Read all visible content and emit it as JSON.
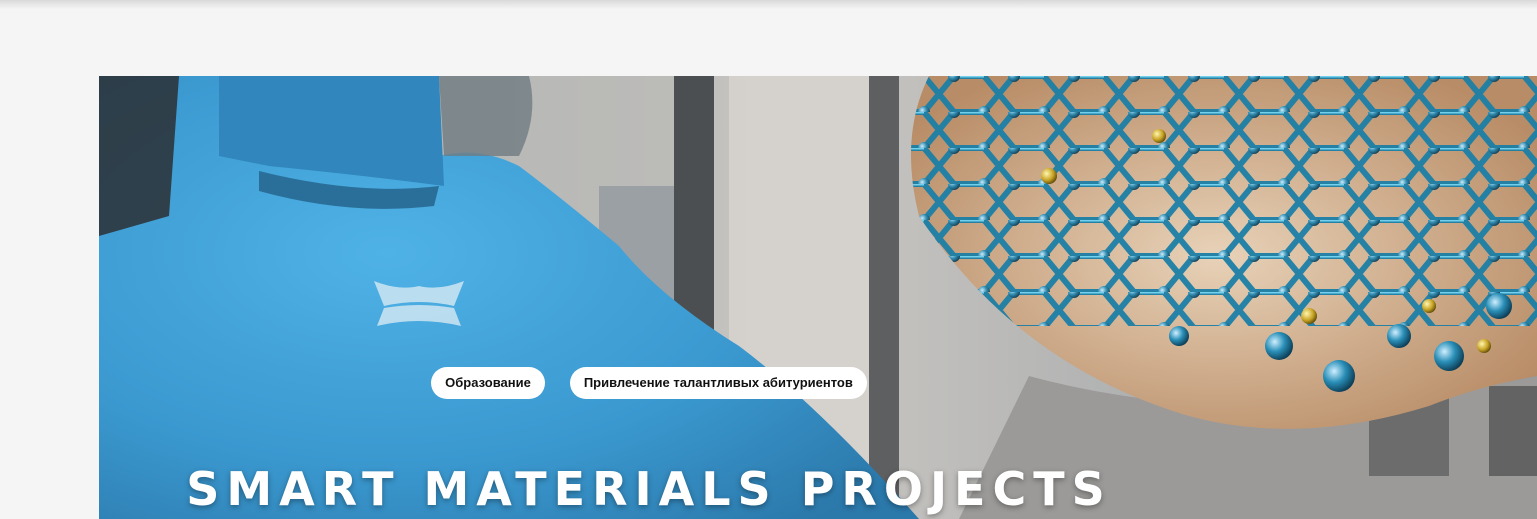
{
  "hero": {
    "tags": [
      "Образование",
      "Привлечение талантливых абитуриентов"
    ],
    "title": "SMART MATERIALS PROJECTS"
  },
  "colors": {
    "page_bg": "#f5f5f5",
    "tag_bg": "#ffffff",
    "shirt_blue": "#3d9ed6"
  }
}
